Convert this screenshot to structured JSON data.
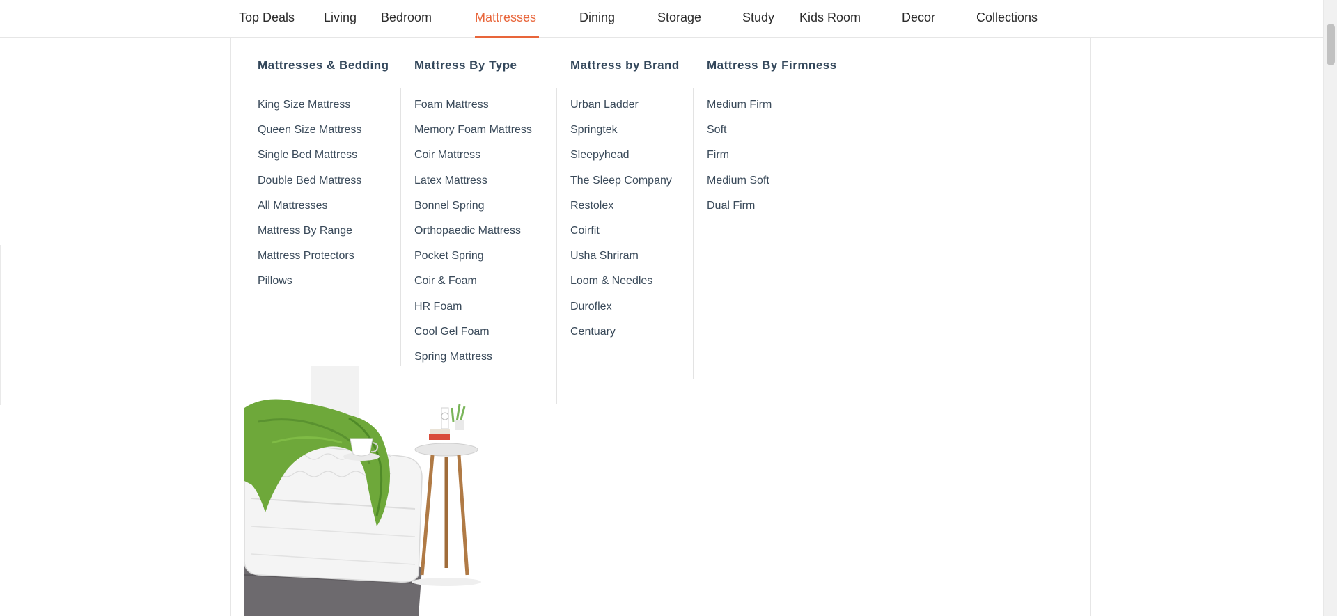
{
  "nav": {
    "items": [
      {
        "label": "Top Deals"
      },
      {
        "label": "Living"
      },
      {
        "label": "Bedroom"
      },
      {
        "label": "Mattresses"
      },
      {
        "label": "Dining"
      },
      {
        "label": "Storage"
      },
      {
        "label": "Study"
      },
      {
        "label": "Kids Room"
      },
      {
        "label": "Decor"
      },
      {
        "label": "Collections"
      }
    ],
    "active": "Mattresses",
    "accent_color": "#e8653a"
  },
  "menu": {
    "columns": [
      {
        "heading": "Mattresses & Bedding",
        "items": [
          "King Size Mattress",
          "Queen Size Mattress",
          "Single Bed Mattress",
          "Double Bed Mattress",
          "All Mattresses",
          "Mattress By Range",
          "Mattress Protectors",
          "Pillows"
        ]
      },
      {
        "heading": "Mattress By Type",
        "items": [
          "Foam Mattress",
          "Memory Foam Mattress",
          "Coir Mattress",
          "Latex Mattress",
          "Bonnel Spring",
          "Orthopaedic Mattress",
          "Pocket Spring",
          "Coir & Foam",
          "HR Foam",
          "Cool Gel Foam",
          "Spring Mattress"
        ]
      },
      {
        "heading": "Mattress by Brand",
        "items": [
          "Urban Ladder",
          "Springtek",
          "Sleepyhead",
          "The Sleep Company",
          "Restolex",
          "Coirfit",
          "Usha Shriram",
          "Loom & Needles",
          "Duroflex",
          "Centuary"
        ]
      },
      {
        "heading": "Mattress By Firmness",
        "items": [
          "Medium Firm",
          "Soft",
          "Firm",
          "Medium Soft",
          "Dual Firm"
        ]
      }
    ]
  },
  "promo": {
    "icon": "mattress-with-side-table-image"
  }
}
